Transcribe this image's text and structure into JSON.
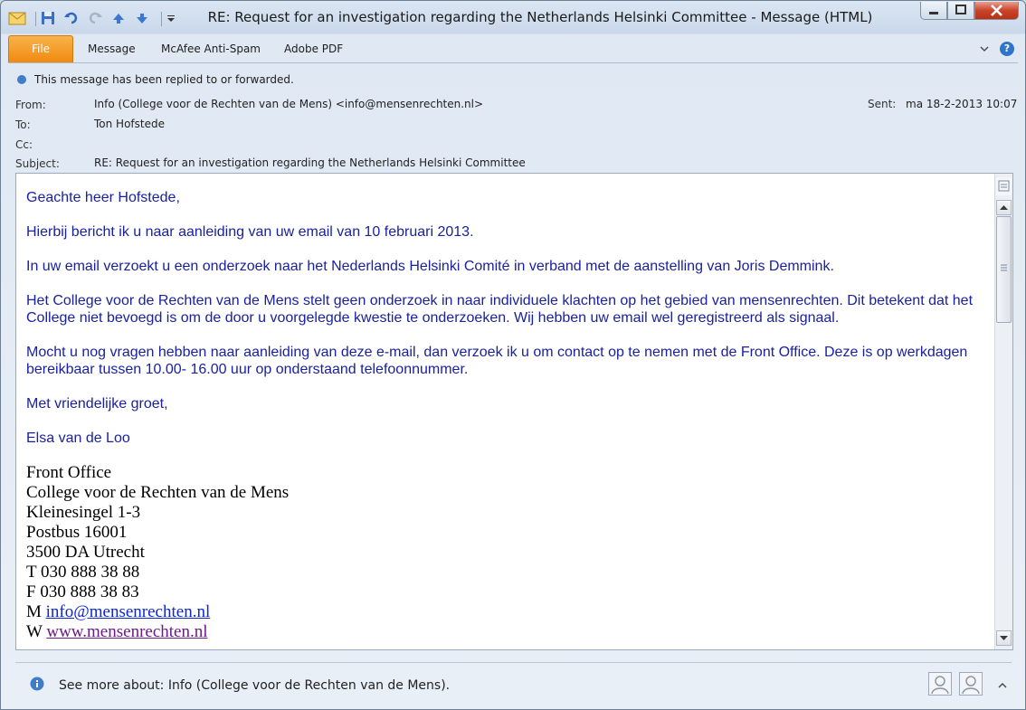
{
  "window": {
    "title": "RE: Request for an investigation regarding the Netherlands Helsinki Committee  -  Message (HTML)"
  },
  "ribbon": {
    "tabs": [
      "File",
      "Message",
      "McAfee Anti-Spam",
      "Adobe PDF"
    ],
    "help_label": "?"
  },
  "header": {
    "info_text": "This message has been replied to or forwarded.",
    "from_label": "From:",
    "from_value": "Info (College voor de  Rechten van de Mens) <info@mensenrechten.nl>",
    "to_label": "To:",
    "to_value": "Ton Hofstede",
    "cc_label": "Cc:",
    "cc_value": "",
    "subject_label": "Subject:",
    "subject_value": "RE: Request for an investigation regarding the Netherlands Helsinki Committee",
    "sent_label": "Sent:",
    "sent_value": "ma 18-2-2013 10:07"
  },
  "body": {
    "greeting": "Geachte heer Hofstede,",
    "paragraphs": [
      "Hierbij bericht ik u naar aanleiding van uw email van 10 februari 2013.",
      "In uw email verzoekt u een onderzoek naar het Nederlands Helsinki Comité in verband met de aanstelling van Joris Demmink.",
      "Het College voor de Rechten van de Mens stelt geen onderzoek in naar individuele klachten op het gebied van mensenrechten. Dit betekent dat het College niet bevoegd is om de door u voorgelegde kwestie te onderzoeken. Wij hebben uw email wel geregistreerd als signaal.",
      "Mocht u nog vragen hebben naar aanleiding van deze e-mail, dan verzoek ik u om contact op te nemen met de Front Office. Deze is op werkdagen bereikbaar tussen 10.00- 16.00 uur op onderstaand telefoonnummer.",
      "Met vriendelijke groet,",
      "Elsa van de Loo"
    ],
    "signature": {
      "line1": "Front Office",
      "line2": "College voor de Rechten van de Mens",
      "line3": "Kleinesingel 1-3",
      "line4": "Postbus 16001",
      "line5": "3500 DA Utrecht",
      "phone": "T 030 888 38 88",
      "fax": "F 030 888 38 83",
      "mail_prefix": "M ",
      "mail_link": "info@mensenrechten.nl",
      "web_prefix": "W ",
      "web_link": "www.mensenrechten.nl"
    }
  },
  "people_pane": {
    "text": "See more about: Info (College voor de  Rechten van de Mens)."
  },
  "icons": {
    "info": "info-icon",
    "avatar": "contact-avatar-icon"
  }
}
